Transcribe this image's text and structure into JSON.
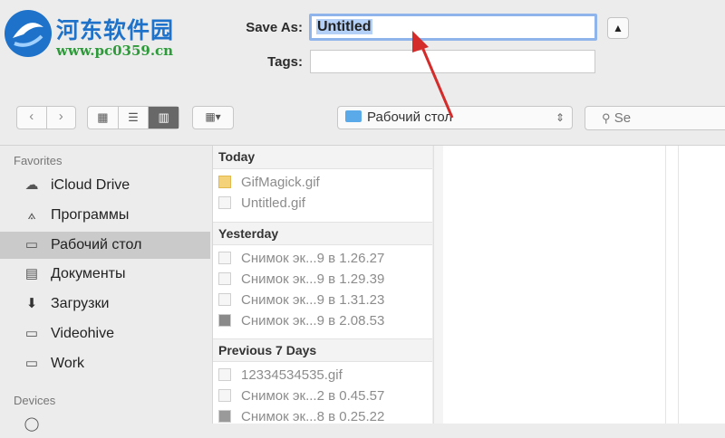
{
  "watermark": {
    "title": "河东软件园",
    "url": "www.pc0359.cn"
  },
  "save_as": {
    "label": "Save As:",
    "value": "Untitled"
  },
  "tags": {
    "label": "Tags:",
    "value": ""
  },
  "toolbar": {
    "back_icon": "chevron-left-icon",
    "forward_icon": "chevron-right-icon",
    "location": "Рабочий стол",
    "search_placeholder": "Se"
  },
  "sidebar": {
    "favorites_title": "Favorites",
    "favorites": [
      {
        "label": "iCloud Drive",
        "icon": "cloud-icon"
      },
      {
        "label": "Программы",
        "icon": "apps-icon"
      },
      {
        "label": "Рабочий стол",
        "icon": "desktop-icon",
        "selected": true
      },
      {
        "label": "Документы",
        "icon": "document-icon"
      },
      {
        "label": "Загрузки",
        "icon": "download-icon"
      },
      {
        "label": "Videohive",
        "icon": "folder-icon"
      },
      {
        "label": "Work",
        "icon": "folder-icon"
      }
    ],
    "devices_title": "Devices"
  },
  "files": {
    "groups": [
      {
        "title": "Today",
        "items": [
          "GifMagick.gif",
          "Untitled.gif"
        ]
      },
      {
        "title": "Yesterday",
        "items": [
          "Снимок эк...9 в 1.26.27",
          "Снимок эк...9 в 1.29.39",
          "Снимок эк...9 в 1.31.23",
          "Снимок эк...9 в 2.08.53"
        ]
      },
      {
        "title": "Previous 7 Days",
        "items": [
          "12334534535.gif",
          "Снимок эк...2 в 0.45.57",
          "Снимок эк...8 в 0.25.22"
        ]
      }
    ]
  },
  "colors": {
    "annotation_arrow": "#d42b2b",
    "selection": "#b5d0f7",
    "focus_ring": "#8fb4ec"
  }
}
